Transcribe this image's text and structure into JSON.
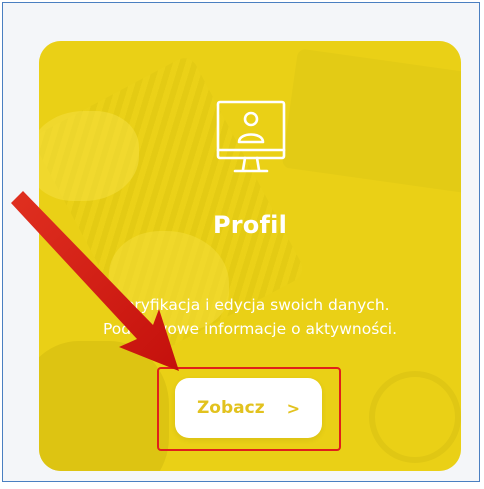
{
  "card": {
    "title": "Profil",
    "description_line1": "Weryfikacja i edycja swoich danych.",
    "description_line2": "Podstawowe informacje o aktywności.",
    "button_label": "Zobacz",
    "icon": "monitor-user-icon",
    "button_icon": "chevron-right-icon"
  },
  "colors": {
    "card_background": "#e6cf1a",
    "button_background": "#ffffff",
    "button_text": "#e2c21e",
    "annotation": "#e0201a"
  }
}
